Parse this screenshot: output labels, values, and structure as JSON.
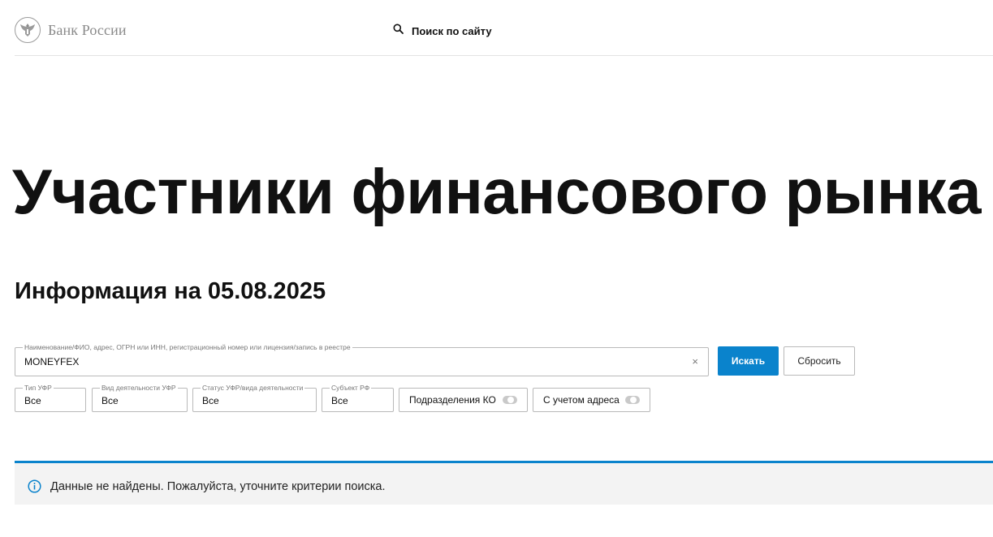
{
  "header": {
    "logo_text": "Банк России",
    "search_label": "Поиск по сайту"
  },
  "page": {
    "title": "Участники финансового рынка",
    "info_date": "Информация на 05.08.2025"
  },
  "search": {
    "legend": "Наименование/ФИО, адрес, ОГРН или ИНН, регистрационный номер или лицензия/запись в реестре",
    "value": "MONEYFEX",
    "clear_symbol": "×",
    "search_button": "Искать",
    "reset_button": "Сбросить"
  },
  "filters": [
    {
      "legend": "Тип УФР",
      "value": "Все"
    },
    {
      "legend": "Вид деятельности УФР",
      "value": "Все"
    },
    {
      "legend": "Статус УФР/вида деятельности",
      "value": "Все"
    },
    {
      "legend": "Субъект РФ",
      "value": "Все"
    }
  ],
  "toggles": [
    {
      "label": "Подразделения КО",
      "on": false
    },
    {
      "label": "С учетом адреса",
      "on": false
    }
  ],
  "notice": {
    "text": "Данные не найдены. Пожалуйста, уточните критерии поиска."
  },
  "colors": {
    "accent": "#0a83cc",
    "notice_bg": "#f3f3f3",
    "border": "#b9b9b9"
  }
}
